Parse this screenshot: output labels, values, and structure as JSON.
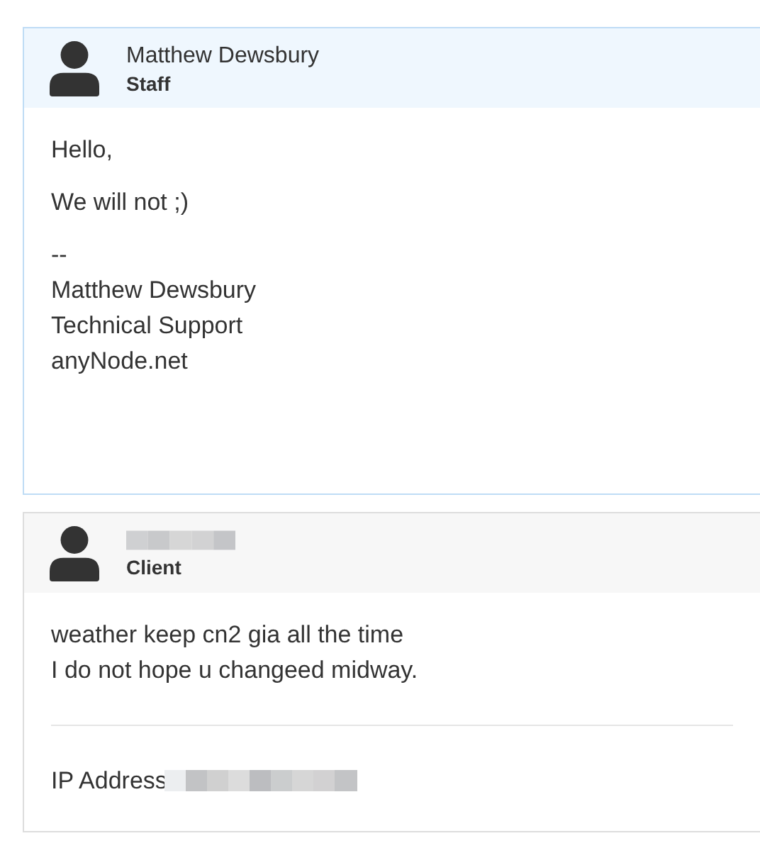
{
  "messages": [
    {
      "kind": "staff",
      "author": {
        "name": "Matthew Dewsbury",
        "redacted": false
      },
      "role": "Staff",
      "paragraphs": [
        "Hello,",
        "We will not ;)",
        "--\nMatthew Dewsbury\nTechnical Support\nanyNode.net"
      ]
    },
    {
      "kind": "client",
      "author": {
        "redacted": true
      },
      "role": "Client",
      "paragraphs": [
        "weather keep cn2 gia all the time\nI do not hope u changeed midway."
      ],
      "ip": {
        "label": "IP Address",
        "redacted": true
      }
    }
  ]
}
